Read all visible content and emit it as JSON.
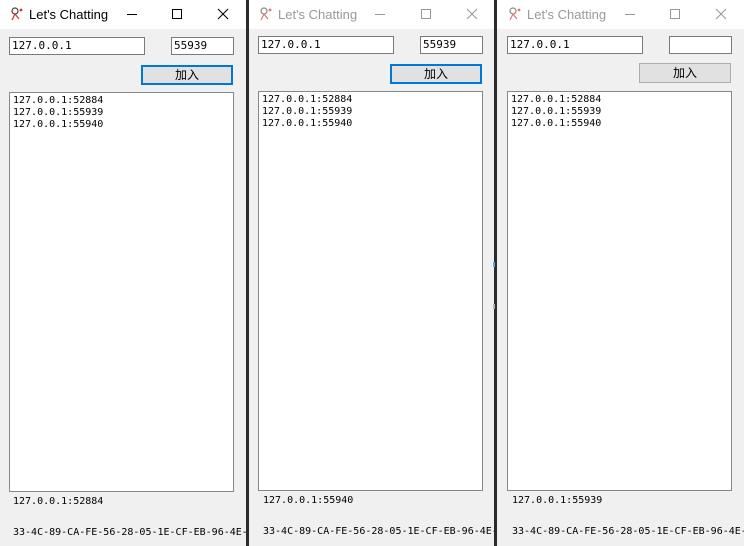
{
  "windows": [
    {
      "title": "Let's Chatting",
      "active": true,
      "ip": "127.0.0.1",
      "port": "55939",
      "join_label": "加入",
      "clients": [
        "127.0.0.1:52884",
        "127.0.0.1:55939",
        "127.0.0.1:55940"
      ],
      "self_addr": "127.0.0.1:52884",
      "mac": "33-4C-89-CA-FE-56-28-05-1E-CF-EB-96-4E-"
    },
    {
      "title": "Let's Chatting",
      "active": false,
      "ip": "127.0.0.1",
      "port": "55939",
      "join_label": "加入",
      "clients": [
        "127.0.0.1:52884",
        "127.0.0.1:55939",
        "127.0.0.1:55940"
      ],
      "self_addr": "127.0.0.1:55940",
      "mac": "33-4C-89-CA-FE-56-28-05-1E-CF-EB-96-4E-"
    },
    {
      "title": "Let's Chatting",
      "active": false,
      "ip": "127.0.0.1",
      "port": "",
      "join_label": "加入",
      "clients": [
        "127.0.0.1:52884",
        "127.0.0.1:55939",
        "127.0.0.1:55940"
      ],
      "self_addr": "127.0.0.1:55939",
      "mac": "33-4C-89-CA-FE-56-28-05-1E-CF-EB-96-4E-"
    }
  ],
  "icons": {
    "app": "app-icon",
    "minimize": "minimize-icon",
    "maximize": "maximize-icon",
    "close": "close-icon"
  },
  "colors": {
    "focus_border": "#0078d7",
    "button_bg": "#e1e1e1",
    "window_bg": "#f0f0f0"
  }
}
